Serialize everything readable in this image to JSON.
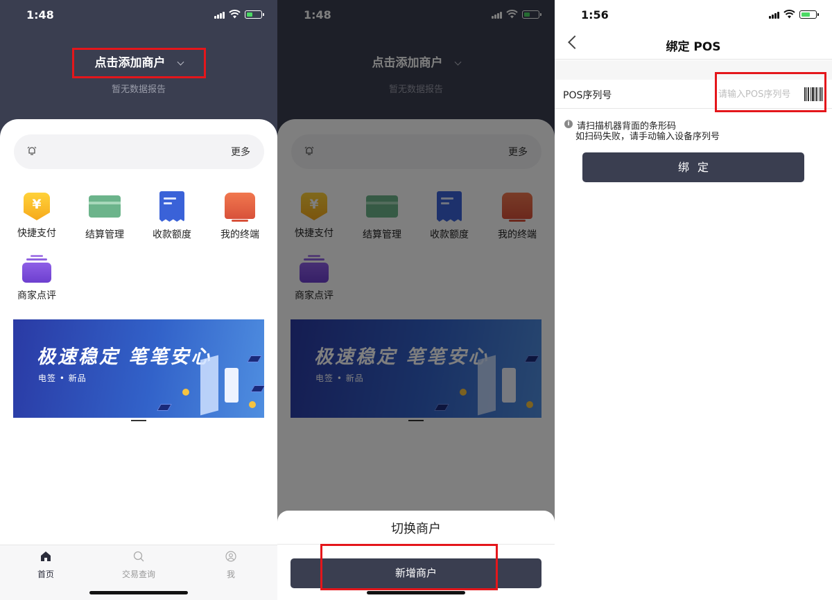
{
  "screen1": {
    "status": {
      "time": "1:48"
    },
    "header": {
      "merchant_label": "点击添加商户",
      "no_data": "暂无数据报告"
    },
    "search": {
      "more": "更多"
    },
    "grid": [
      {
        "label": "快捷支付",
        "icon": "yen-badge-icon"
      },
      {
        "label": "结算管理",
        "icon": "card-icon"
      },
      {
        "label": "收款额度",
        "icon": "receipt-icon"
      },
      {
        "label": "我的终端",
        "icon": "terminal-icon"
      },
      {
        "label": "商家点评",
        "icon": "folder-icon"
      }
    ],
    "banner": {
      "slogan": "极速稳定 笔笔安心",
      "sub": "电签 • 新品"
    },
    "tabs": [
      {
        "label": "首页",
        "icon": "home-icon",
        "active": true
      },
      {
        "label": "交易查询",
        "icon": "search-icon",
        "active": false
      },
      {
        "label": "我",
        "icon": "user-icon",
        "active": false
      }
    ]
  },
  "screen2": {
    "sheet": {
      "title": "切换商户",
      "add_button": "新增商户"
    }
  },
  "screen3": {
    "status": {
      "time": "1:56"
    },
    "nav": {
      "title": "绑定 POS"
    },
    "form": {
      "label": "POS序列号",
      "placeholder": "请输入POS序列号"
    },
    "hint": {
      "line1": "请扫描机器背面的条形码",
      "line2": "如扫码失败，请手动输入设备序列号"
    },
    "bind_button": "绑定"
  },
  "colors": {
    "header_dark": "#3a3e50",
    "highlight": "#e4161b",
    "battery": "#4cd964"
  }
}
